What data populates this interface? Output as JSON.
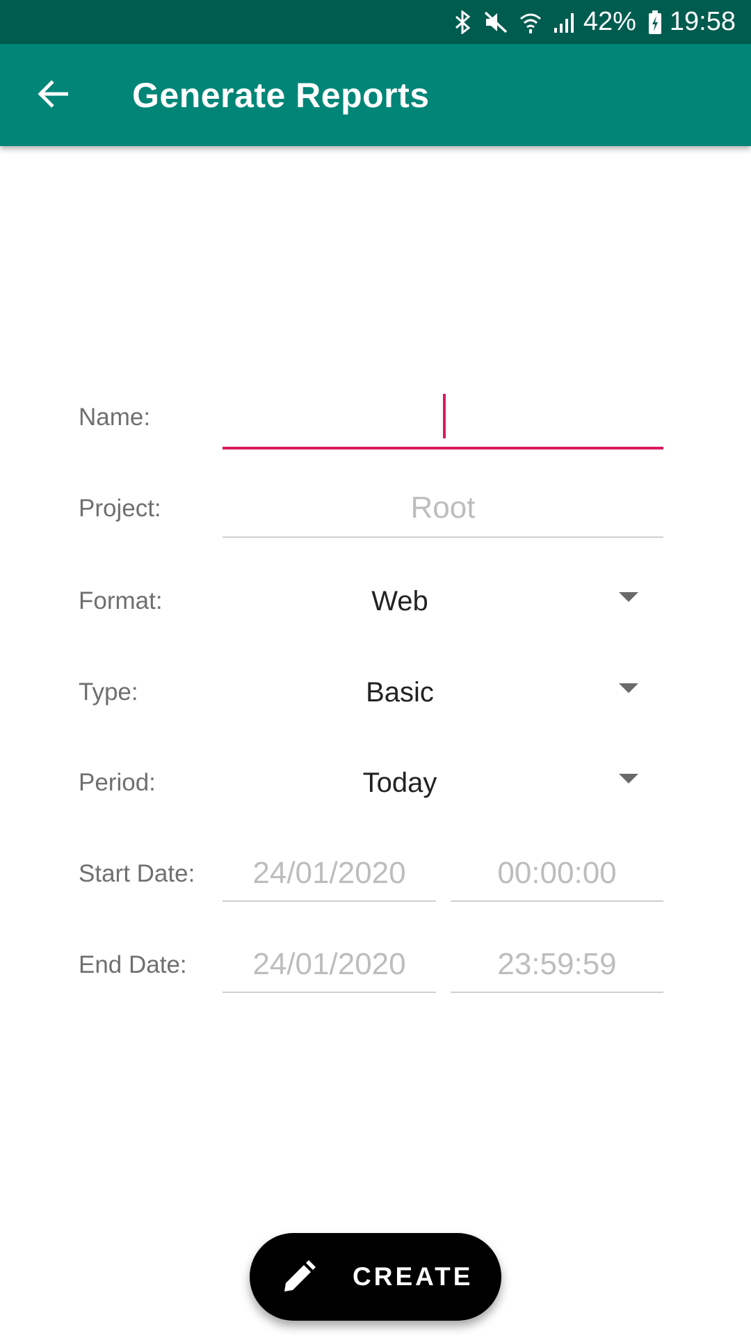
{
  "status_bar": {
    "battery": "42%",
    "time": "19:58",
    "icons": [
      "bluetooth-icon",
      "mute-icon",
      "wifi-icon",
      "signal-icon",
      "battery-charging-icon"
    ]
  },
  "app_bar": {
    "title": "Generate Reports",
    "back_icon": "arrow-back-icon"
  },
  "form": {
    "name": {
      "label": "Name:",
      "value": ""
    },
    "project": {
      "label": "Project:",
      "value": "Root"
    },
    "format": {
      "label": "Format:",
      "value": "Web"
    },
    "type": {
      "label": "Type:",
      "value": "Basic"
    },
    "period": {
      "label": "Period:",
      "value": "Today"
    },
    "start_date": {
      "label": "Start Date:",
      "date": "24/01/2020",
      "time": "00:00:00"
    },
    "end_date": {
      "label": "End Date:",
      "date": "24/01/2020",
      "time": "23:59:59"
    }
  },
  "fab": {
    "label": "CREATE",
    "icon": "pencil-icon"
  },
  "colors": {
    "status_bar": "#005c4f",
    "app_bar": "#008577",
    "accent": "#d81b60",
    "fab": "#000000"
  }
}
